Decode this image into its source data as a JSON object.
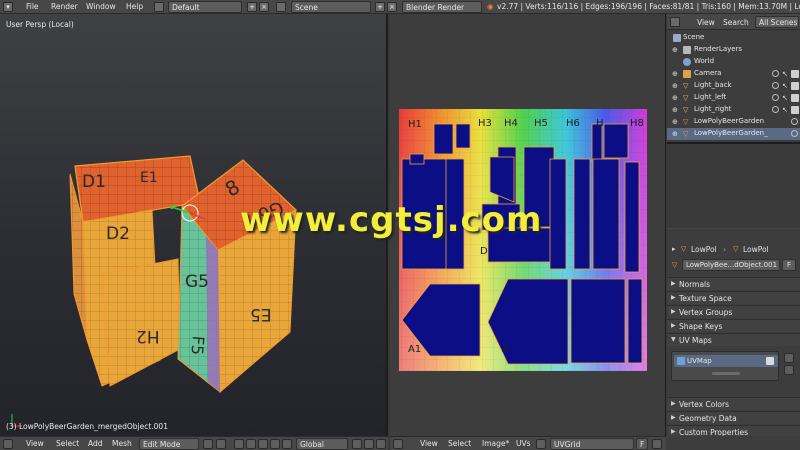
{
  "topbar": {
    "menu": [
      "File",
      "Render",
      "Window",
      "Help"
    ],
    "layout": "Default",
    "scene": "Scene",
    "engine": "Blender Render",
    "stats": "v2.77 | Verts:116/116 | Edges:196/196 | Faces:81/81 | Tris:160 | Mem:13.70M | LowPolyB"
  },
  "viewport": {
    "view_label": "User Persp (Local)",
    "object_label": "(3) LowPolyBeerGarden_mergedObject.001",
    "face_labels": {
      "d1": "D1",
      "e1": "E1",
      "d2": "D2",
      "g5": "G5",
      "e5": "E5",
      "h2": "H2",
      "f5": "F5",
      "r8": "8",
      "g6": "G6"
    },
    "header": {
      "view": "View",
      "select": "Select",
      "add": "Add",
      "mesh": "Mesh",
      "mode": "Edit Mode",
      "orientation": "Global"
    }
  },
  "uv_editor": {
    "labels": [
      "H1",
      "H3",
      "H4",
      "H5",
      "H6",
      "H",
      "H8",
      "G",
      "G5",
      "G7",
      "A1",
      "A",
      "D"
    ],
    "header": {
      "view": "View",
      "select": "Select",
      "image": "Image*",
      "uvs": "UVs",
      "image_name": "UVGrid",
      "f_button": "F"
    }
  },
  "outliner": {
    "tabs": [
      "View",
      "Search",
      "All Scenes"
    ],
    "items": [
      {
        "label": "Scene",
        "indent": 0
      },
      {
        "label": "RenderLayers",
        "indent": 1
      },
      {
        "label": "World",
        "indent": 1
      },
      {
        "label": "Camera",
        "indent": 1
      },
      {
        "label": "Light_back",
        "indent": 1
      },
      {
        "label": "Light_left",
        "indent": 1
      },
      {
        "label": "Light_right",
        "indent": 1
      },
      {
        "label": "LowPolyBeerGarden",
        "indent": 1
      },
      {
        "label": "LowPolyBeerGarden_",
        "indent": 1
      }
    ]
  },
  "properties": {
    "breadcrumb": "LowPol",
    "breadcrumb2": "LowPol",
    "mesh_name": "LowPolyBee...dObject.001",
    "f_button": "F",
    "panels": [
      "Normals",
      "Texture Space",
      "Vertex Groups",
      "Shape Keys",
      "UV Maps",
      "Vertex Colors",
      "Geometry Data",
      "Custom Properties"
    ],
    "uv_map": "UVMap"
  },
  "watermark": "www.cgtsj.com"
}
